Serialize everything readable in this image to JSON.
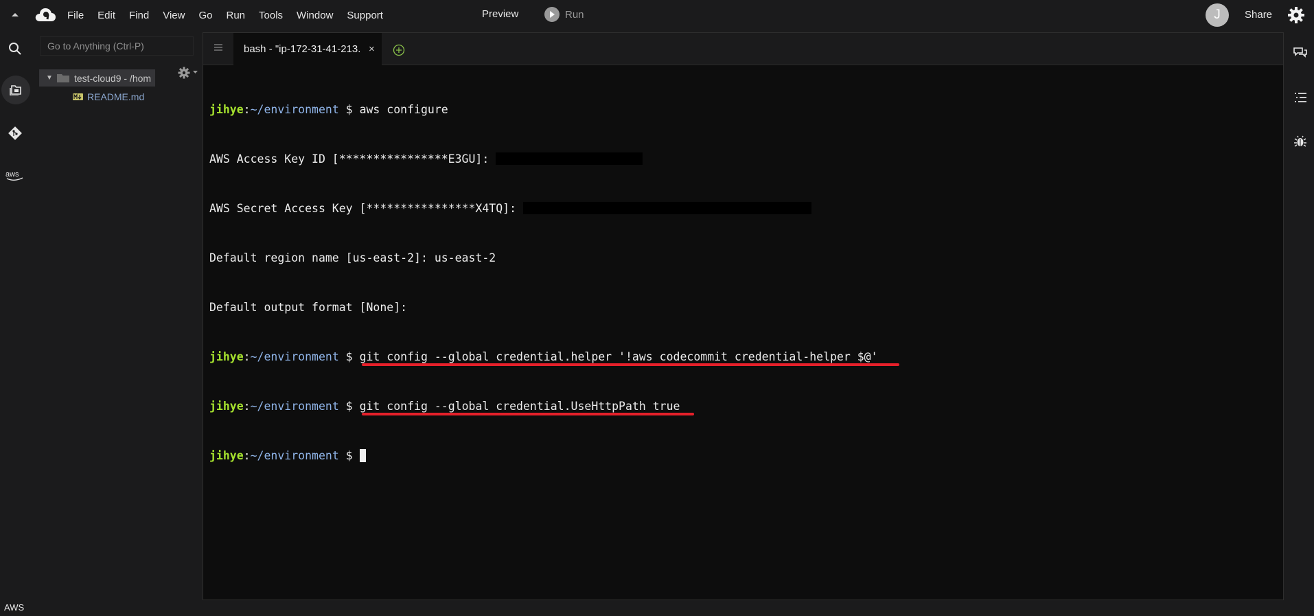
{
  "menubar": {
    "items": [
      "File",
      "Edit",
      "Find",
      "View",
      "Go",
      "Run",
      "Tools",
      "Window",
      "Support"
    ],
    "preview": "Preview",
    "run": "Run",
    "avatar_initial": "J",
    "share": "Share"
  },
  "sidebar": {
    "goto_placeholder": "Go to Anything (Ctrl-P)",
    "root_folder": "test-cloud9 - /hom",
    "files": [
      "README.md"
    ]
  },
  "tabs": {
    "active_title": "bash - \"ip-172-31-41-213.",
    "close": "×"
  },
  "terminal": {
    "user": "jihye",
    "path": "~/environment",
    "prompt_symbol": " $ ",
    "cmd1": "aws configure",
    "access_key_prompt": "AWS Access Key ID [****************E3GU]:",
    "secret_key_prompt": "AWS Secret Access Key [****************X4TQ]:",
    "region_prompt": "Default region name [us-east-2]: us-east-2",
    "output_prompt": "Default output format [None]:",
    "cmd2": "git config --global credential.helper '!aws codecommit credential-helper $@'",
    "cmd3": "git config --global credential.UseHttpPath true"
  },
  "footer": {
    "label": "AWS"
  },
  "colors": {
    "user_green": "#a6e22e",
    "path_blue": "#8fb4e8",
    "underline_red": "#e5202a"
  },
  "icons": {
    "activity": [
      "search-icon",
      "files-icon",
      "git-icon",
      "aws-icon"
    ],
    "rail": [
      "chat-icon",
      "outline-icon",
      "debugger-icon"
    ]
  }
}
